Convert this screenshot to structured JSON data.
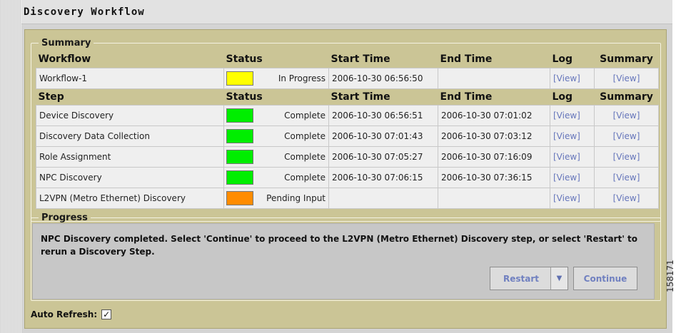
{
  "window": {
    "title": "Discovery Workflow"
  },
  "summary": {
    "legend": "Summary",
    "workflow_headers": {
      "name": "Workflow",
      "status": "Status",
      "start": "Start Time",
      "end": "End Time",
      "log": "Log",
      "summary": "Summary"
    },
    "workflow": {
      "name": "Workflow-1",
      "status": "In Progress",
      "status_color": "#ffff00",
      "start": "2006-10-30 06:56:50",
      "end": "",
      "log": "[View]",
      "summary": "[View]"
    },
    "step_headers": {
      "name": "Step",
      "status": "Status",
      "start": "Start Time",
      "end": "End Time",
      "log": "Log",
      "summary": "Summary"
    },
    "steps": [
      {
        "name": "Device Discovery",
        "status": "Complete",
        "status_color": "#00ee00",
        "start": "2006-10-30 06:56:51",
        "end": "2006-10-30 07:01:02",
        "log": "[View]",
        "summary": "[View]"
      },
      {
        "name": "Discovery Data Collection",
        "status": "Complete",
        "status_color": "#00ee00",
        "start": "2006-10-30 07:01:43",
        "end": "2006-10-30 07:03:12",
        "log": "[View]",
        "summary": "[View]"
      },
      {
        "name": "Role Assignment",
        "status": "Complete",
        "status_color": "#00ee00",
        "start": "2006-10-30 07:05:27",
        "end": "2006-10-30 07:16:09",
        "log": "[View]",
        "summary": "[View]"
      },
      {
        "name": "NPC Discovery",
        "status": "Complete",
        "status_color": "#00ee00",
        "start": "2006-10-30 07:06:15",
        "end": "2006-10-30 07:36:15",
        "log": "[View]",
        "summary": "[View]"
      },
      {
        "name": "L2VPN (Metro Ethernet) Discovery",
        "status": "Pending Input",
        "status_color": "#ff8c00",
        "start": "",
        "end": "",
        "log": "[View]",
        "summary": "[View]"
      }
    ]
  },
  "progress": {
    "legend": "Progress",
    "message": "NPC Discovery completed. Select 'Continue' to proceed to the L2VPN (Metro Ethernet) Discovery step, or select 'Restart' to rerun a Discovery Step.",
    "restart_label": "Restart",
    "restart_arrow_icon": "dropdown-arrow-icon",
    "continue_label": "Continue"
  },
  "auto_refresh": {
    "label": "Auto Refresh:",
    "checked": true
  },
  "figure_number": "158171",
  "colors": {
    "panel": "#cbc596",
    "link": "#6676bb"
  }
}
